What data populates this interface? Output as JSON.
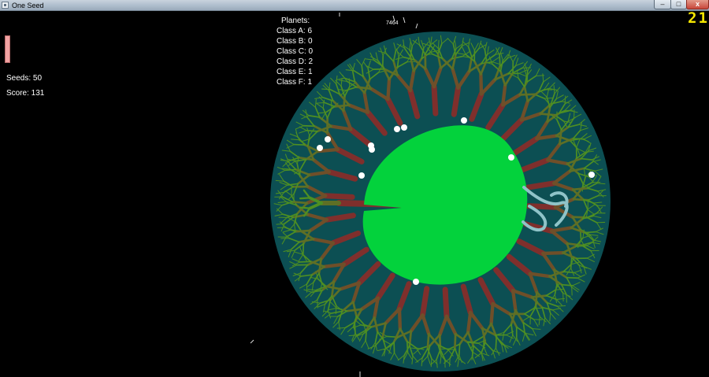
{
  "window": {
    "title": "One Seed"
  },
  "window_controls": {
    "minimize": "–",
    "maximize": "□",
    "close": "x"
  },
  "hud": {
    "seeds": "Seeds: 50",
    "score": "Score: 131",
    "health_level": 1.0,
    "timer": "21",
    "counter": "7464"
  },
  "planets": {
    "title": "Planets:",
    "classes": [
      "Class A: 6",
      "Class B: 0",
      "Class C: 0",
      "Class D: 2",
      "Class E: 1",
      "Class F: 1"
    ]
  },
  "colors": {
    "background": "#000000",
    "atmosphere": "#0c4f53",
    "planet_core": "#03d23c",
    "branch_red": "#7f2f2c",
    "branch_green": "#4e8f22",
    "seed": "#ffffff",
    "timer": "#f4e600"
  }
}
